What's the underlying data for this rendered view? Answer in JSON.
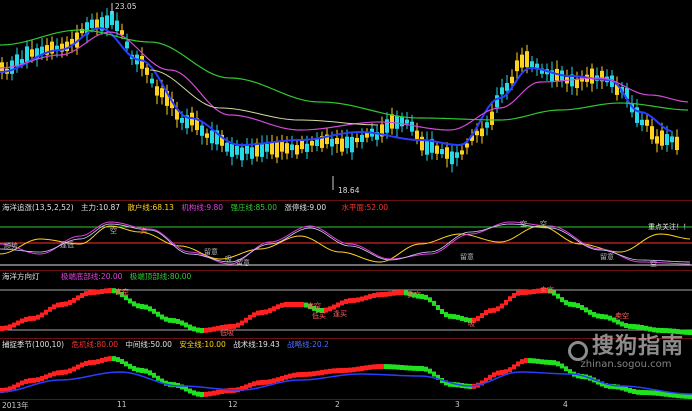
{
  "price_panel": {
    "high_label": "23.05",
    "low_label": "18.64",
    "colors": {
      "up": "#ffd21f",
      "down": "#25d9e6",
      "ma_fast": "#2a3dff",
      "ma_mid": "#d04ad8",
      "ma_slow": "#30c830"
    }
  },
  "indicator1": {
    "name": "海洋追涨(13,5,2,52)",
    "items": [
      {
        "label": "主力:",
        "value": "10.87",
        "color": "#e0e0e0"
      },
      {
        "label": "散户线:",
        "value": "68.13",
        "color": "#ffd21f"
      },
      {
        "label": "机构线:",
        "value": "9.80",
        "color": "#e040e0"
      },
      {
        "label": "强庄线:",
        "value": "85.00",
        "color": "#30c830"
      },
      {
        "label": "涨停线:",
        "value": "9.00",
        "color": "#e0e0e0"
      },
      {
        "label": "水平面:",
        "value": "52.00",
        "color": "#ff3030"
      }
    ],
    "tags": [
      "顺势",
      "逢低",
      "留意",
      "吸",
      "留意",
      "卖",
      "空",
      "留意",
      "空",
      "留意",
      "重点关注！！",
      "空",
      "空"
    ]
  },
  "indicator2": {
    "name": "海洋方向灯",
    "items": [
      {
        "label": "极端底部线:",
        "value": "20.00",
        "color": "#e040e0"
      },
      {
        "label": "极端顶部线:",
        "value": "80.00",
        "color": "#30c830"
      }
    ],
    "tags": [
      "卖空",
      "卖空",
      "低吸",
      "逢买",
      "低买",
      "卖空",
      "卖空",
      "卖空",
      "吸"
    ]
  },
  "indicator3": {
    "name": "捕捉季节(100,10)",
    "items": [
      {
        "label": "危机线:",
        "value": "80.00",
        "color": "#ff3030"
      },
      {
        "label": "中间线:",
        "value": "50.00",
        "color": "#e0e0e0"
      },
      {
        "label": "安全线:",
        "value": "10.00",
        "color": "#ffd21f"
      },
      {
        "label": "战术线:",
        "value": "19.43",
        "color": "#e0e0e0"
      },
      {
        "label": "战略线:",
        "value": "20.2",
        "color": "#2a3dff"
      }
    ]
  },
  "axis": {
    "ticks": [
      "2013年",
      "11",
      "12",
      "2",
      "3",
      "4"
    ]
  },
  "watermark": {
    "main": "搜狗指南",
    "sub": "zhinan.sogou.com"
  }
}
